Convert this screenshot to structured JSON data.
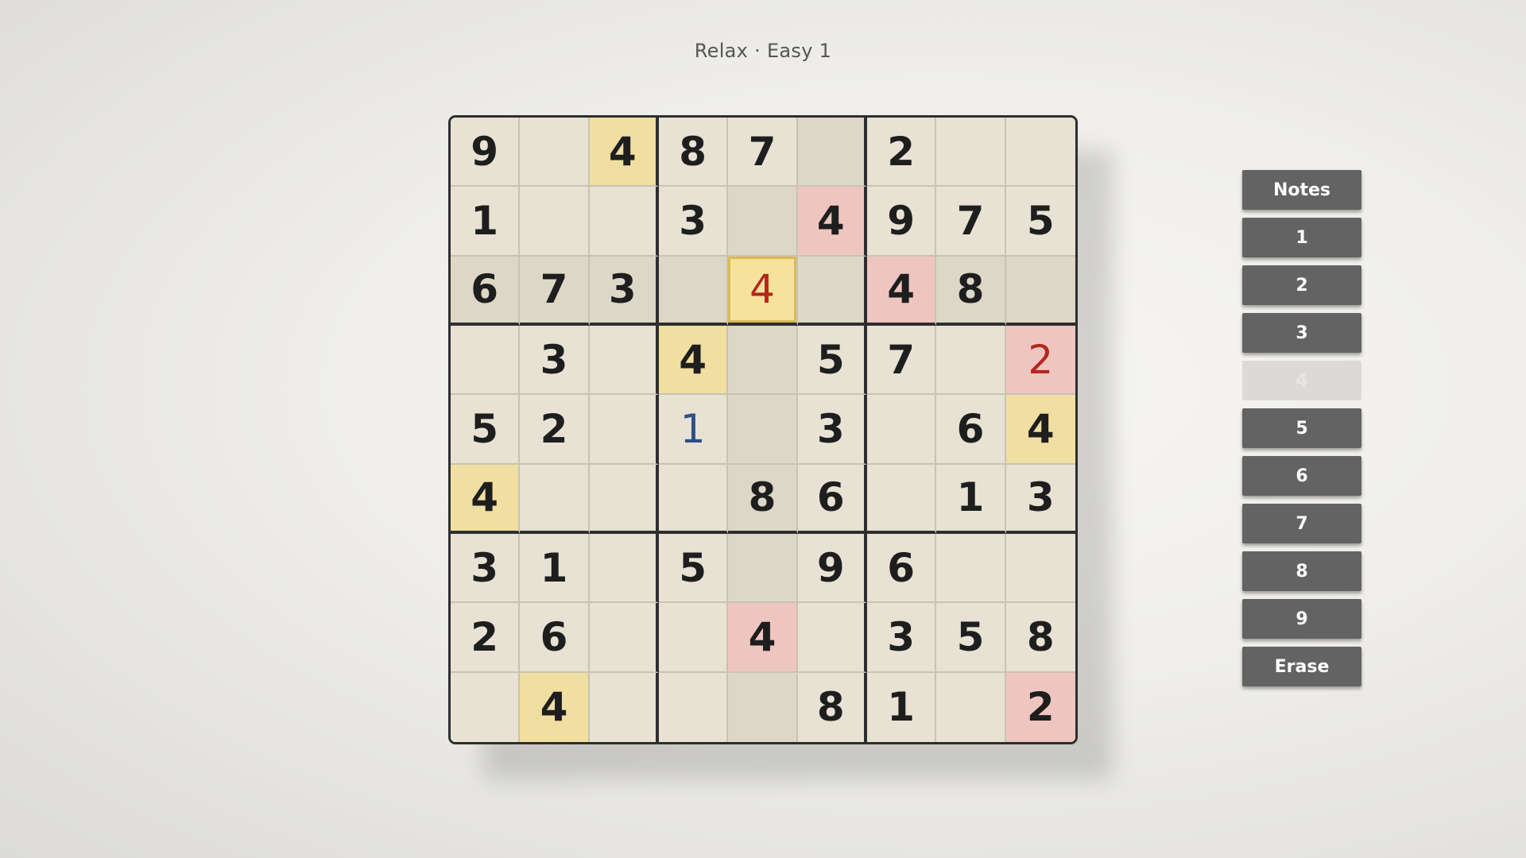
{
  "header": {
    "title": "Relax · Easy  1"
  },
  "board": {
    "values": [
      [
        "9",
        "",
        "4",
        "8",
        "7",
        "",
        "2",
        "",
        ""
      ],
      [
        "1",
        "",
        "",
        "3",
        "",
        "4",
        "9",
        "7",
        "5"
      ],
      [
        "6",
        "7",
        "3",
        "",
        "4",
        "",
        "4",
        "8",
        ""
      ],
      [
        "",
        "3",
        "",
        "4",
        "",
        "5",
        "7",
        "",
        "2"
      ],
      [
        "5",
        "2",
        "",
        "1",
        "",
        "3",
        "",
        "6",
        "4"
      ],
      [
        "4",
        "",
        "",
        "",
        "8",
        "6",
        "",
        "1",
        "3"
      ],
      [
        "3",
        "1",
        "",
        "5",
        "",
        "9",
        "6",
        "",
        ""
      ],
      [
        "2",
        "6",
        "",
        "",
        "4",
        "",
        "3",
        "5",
        "8"
      ],
      [
        "",
        "4",
        "",
        "",
        "",
        "8",
        "1",
        "",
        "2"
      ]
    ],
    "kind": [
      [
        "given",
        "",
        "given",
        "given",
        "given",
        "",
        "given",
        "",
        ""
      ],
      [
        "given",
        "",
        "",
        "given",
        "",
        "given",
        "given",
        "given",
        "given"
      ],
      [
        "given",
        "given",
        "given",
        "",
        "error",
        "",
        "given",
        "given",
        ""
      ],
      [
        "",
        "given",
        "",
        "given",
        "",
        "given",
        "given",
        "",
        "error"
      ],
      [
        "given",
        "given",
        "",
        "user",
        "",
        "given",
        "",
        "given",
        "given"
      ],
      [
        "given",
        "",
        "",
        "",
        "given",
        "given",
        "",
        "given",
        "given"
      ],
      [
        "given",
        "given",
        "",
        "given",
        "",
        "given",
        "given",
        "",
        ""
      ],
      [
        "given",
        "given",
        "",
        "",
        "given",
        "",
        "given",
        "given",
        "given"
      ],
      [
        "",
        "given",
        "",
        "",
        "",
        "given",
        "given",
        "",
        "given"
      ]
    ],
    "state": [
      [
        "",
        "",
        "same",
        "",
        "",
        "hl",
        "",
        "",
        ""
      ],
      [
        "",
        "",
        "",
        "",
        "hl",
        "conflict",
        "",
        "",
        ""
      ],
      [
        "hl",
        "hl",
        "hl",
        "hl",
        "selected",
        "hl",
        "conflict",
        "hl",
        "hl"
      ],
      [
        "",
        "",
        "",
        "same",
        "hl",
        "",
        "",
        "",
        "conflict"
      ],
      [
        "",
        "",
        "",
        "",
        "hl",
        "",
        "",
        "",
        "same"
      ],
      [
        "same",
        "",
        "",
        "",
        "hl",
        "",
        "",
        "",
        ""
      ],
      [
        "",
        "",
        "",
        "",
        "hl",
        "",
        "",
        "",
        ""
      ],
      [
        "",
        "",
        "",
        "",
        "conflict",
        "",
        "",
        "",
        ""
      ],
      [
        "",
        "same",
        "",
        "",
        "hl",
        "",
        "",
        "",
        "conflict"
      ]
    ],
    "colors": {
      "highlight": "#ddd7c7",
      "same_number": "#f0dfa0",
      "conflict": "#efc5c0",
      "selected": "#f6e29a",
      "user_digit": "#2e4f86",
      "error_digit": "#b3271e"
    }
  },
  "pad": {
    "notes_label": "Notes",
    "digits": [
      {
        "label": "1",
        "enabled": true
      },
      {
        "label": "2",
        "enabled": true
      },
      {
        "label": "3",
        "enabled": true
      },
      {
        "label": "4",
        "enabled": false
      },
      {
        "label": "5",
        "enabled": true
      },
      {
        "label": "6",
        "enabled": true
      },
      {
        "label": "7",
        "enabled": true
      },
      {
        "label": "8",
        "enabled": true
      },
      {
        "label": "9",
        "enabled": true
      }
    ],
    "erase_label": "Erase"
  }
}
